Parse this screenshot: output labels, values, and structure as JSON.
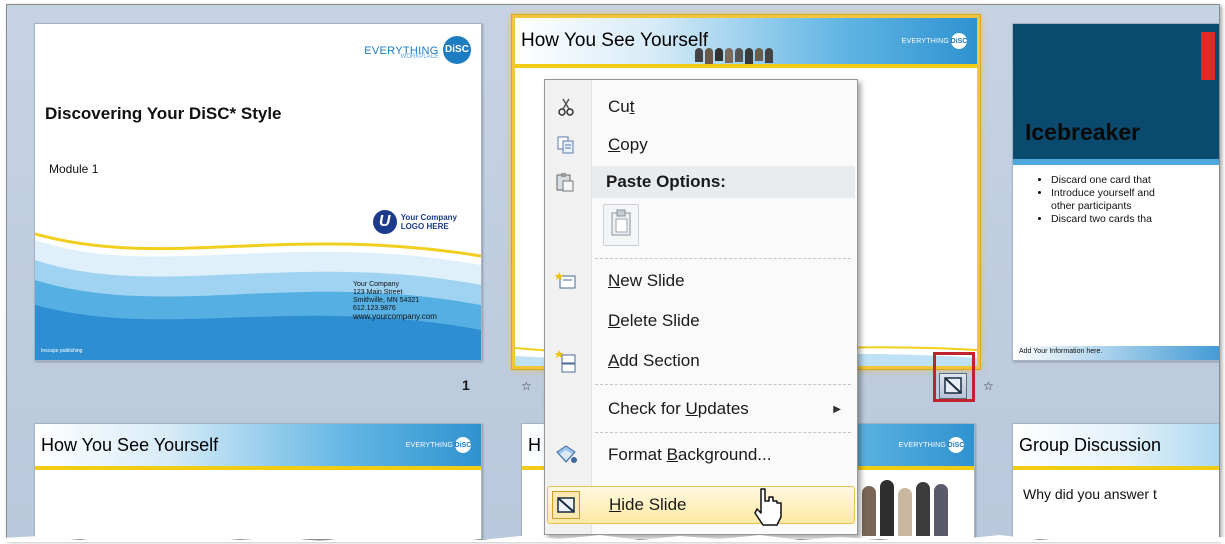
{
  "slides": {
    "slide1": {
      "brand_line1": "EVERYTHING",
      "brand_disc": "DiSC",
      "brand_line2": "WORKPLACE",
      "title": "Discovering Your DiSC",
      "title_suffix": "* Style",
      "subtitle": "Module 1",
      "logo_line1": "Your Company",
      "logo_line2": "LOGO HERE",
      "address_lines": [
        "Your Company",
        "123 Main Street",
        "Smithville, MN 54321",
        "612.123.9876",
        "www.yourcompany.com"
      ],
      "footer": "Inscape publishing",
      "number": "1"
    },
    "slide2": {
      "title": "How You See Yourself",
      "brand": "EVERYTHING",
      "brand_disc": "DiSC"
    },
    "slide3": {
      "title": "Icebreaker",
      "bullets": [
        "Discard one card that",
        "Introduce yourself and",
        "other participants",
        "Discard two cards tha"
      ],
      "footer": "Add Your Information here."
    },
    "slide4": {
      "title": "How You See Yourself",
      "brand": "EVERYTHING",
      "brand_disc": "DiSC"
    },
    "slide5": {
      "title_fragment": "H",
      "brand": "EVERYTHING",
      "brand_disc": "DiSC"
    },
    "slide6": {
      "title": "Group Discussion",
      "body": "Why did you answer t"
    }
  },
  "context_menu": {
    "items": [
      {
        "label": "Cut",
        "icon": "scissors-icon"
      },
      {
        "label": "Copy",
        "icon": "copy-icon"
      },
      {
        "label": "Paste Options:",
        "icon": "paste-icon"
      },
      {
        "label": "New Slide",
        "icon": "new-slide-icon"
      },
      {
        "label": "Delete Slide",
        "icon": ""
      },
      {
        "label": "Add Section",
        "icon": "add-section-icon"
      },
      {
        "label": "Check for Updates",
        "icon": ""
      },
      {
        "label": "Format Background...",
        "icon": "format-background-icon"
      },
      {
        "label": "Hide Slide",
        "icon": "hide-slide-icon"
      }
    ],
    "hovered_item": "Hide Slide"
  },
  "colors": {
    "accent_yellow": "#f0cd12",
    "highlight_red": "#c0232d",
    "title_blue": "#0b4a6f"
  }
}
